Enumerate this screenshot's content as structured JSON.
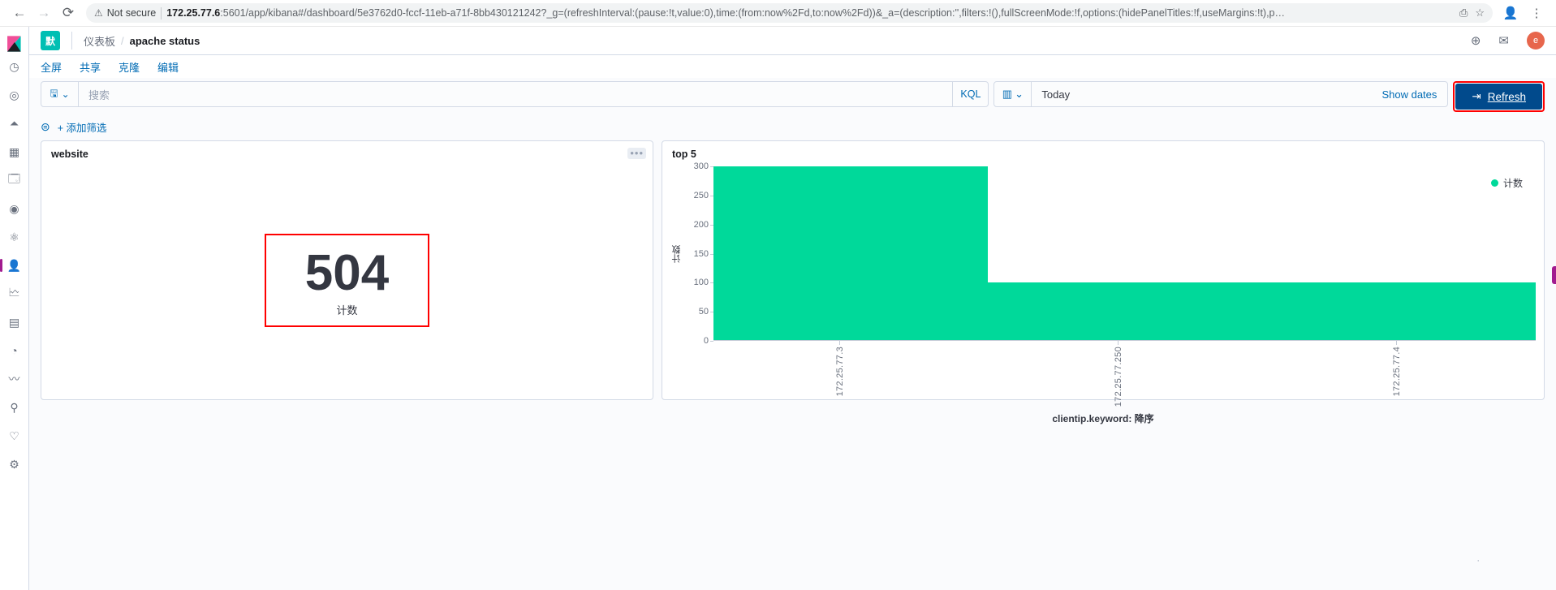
{
  "browser": {
    "back_icon": "←",
    "forward_icon": "→",
    "reload_icon": "⟳",
    "security_label": "Not secure",
    "url_host": "172.25.77.6",
    "url_rest": ":5601/app/kibana#/dashboard/5e3762d0-fccf-11eb-a71f-8bb430121242?_g=(refreshInterval:(pause:!t,value:0),time:(from:now%2Fd,to:now%2Fd))&_a=(description:'',filters:!(),fullScreenMode:!f,options:(hidePanelTitles:!f,useMargins:!t),p…",
    "translate_icon": "⎙",
    "bookmark_icon": "☆",
    "profile_icon": "👤",
    "menu_icon": "⋮"
  },
  "sidebar": {
    "logo_name": "kibana-logo",
    "items": [
      {
        "name": "recent-icon",
        "glyph": "◷"
      },
      {
        "name": "discover-icon",
        "glyph": "◎"
      },
      {
        "name": "visualize-icon",
        "glyph": "⏶"
      },
      {
        "name": "dashboard-icon",
        "glyph": "▦"
      },
      {
        "name": "canvas-icon",
        "glyph": "🗔"
      },
      {
        "name": "maps-icon",
        "glyph": "◉"
      },
      {
        "name": "ml-icon",
        "glyph": "⚛"
      },
      {
        "name": "infrastructure-icon",
        "glyph": "👤"
      },
      {
        "name": "logs-icon",
        "glyph": "🗠"
      },
      {
        "name": "apm-icon",
        "glyph": "▤"
      },
      {
        "name": "uptime-icon",
        "glyph": "◔"
      },
      {
        "name": "siem-icon",
        "glyph": "〰"
      },
      {
        "name": "dev-tools-icon",
        "glyph": "⚲"
      },
      {
        "name": "monitoring-icon",
        "glyph": "♡"
      },
      {
        "name": "management-icon",
        "glyph": "⚙"
      }
    ]
  },
  "header": {
    "space_badge": "默",
    "breadcrumb_parent": "仪表板",
    "breadcrumb_separator": "/",
    "breadcrumb_current": "apache status",
    "globe_icon": "⊕",
    "mail_icon": "✉",
    "avatar_initial": "e"
  },
  "dashboard_actions": {
    "fullscreen": "全屏",
    "share": "共享",
    "clone": "克隆",
    "edit": "编辑"
  },
  "query": {
    "saved_query_icon": "🖫",
    "saved_query_chevron": "⌄",
    "search_placeholder": "搜索",
    "search_value": "",
    "kql_label": "KQL",
    "calendar_icon": "▥",
    "calendar_chevron": "⌄",
    "date_value": "Today",
    "show_dates_label": "Show dates",
    "refresh_icon": "⇥",
    "refresh_label": "Refresh"
  },
  "filters": {
    "filter_icon": "⊜",
    "add_filter_label": "+ 添加筛选"
  },
  "panels": {
    "metric_panel": {
      "title": "website",
      "menu_icon": "•••",
      "value": "504",
      "label": "计数"
    },
    "chart_panel": {
      "title": "top 5"
    }
  },
  "chart_data": {
    "type": "bar",
    "title": "top 5",
    "categories": [
      "172.25.77.3",
      "172.25.77.250",
      "172.25.77.4"
    ],
    "values": [
      300,
      100,
      100
    ],
    "series": [
      {
        "name": "计数",
        "values": [
          300,
          100,
          100
        ]
      }
    ],
    "xlabel": "clientip.keyword: 降序",
    "ylabel": "计数",
    "ylim": [
      0,
      300
    ],
    "yticks": [
      0,
      50,
      100,
      150,
      200,
      250,
      300
    ],
    "legend": [
      "计数"
    ],
    "legend_position": "right",
    "grid": false,
    "bar_color": "#00d99a"
  },
  "misc": {
    "page_dot": "·"
  }
}
